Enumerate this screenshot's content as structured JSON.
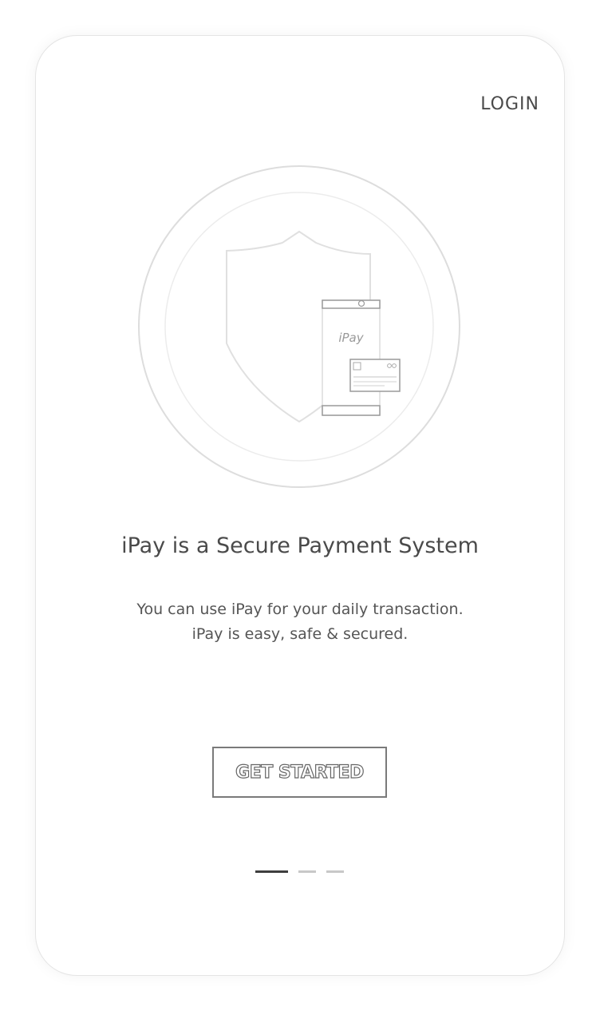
{
  "header": {
    "login_label": "LOGIN"
  },
  "illustration": {
    "icons": [
      "shield-icon",
      "phone-icon",
      "credit-card-icon"
    ],
    "phone_brand": "iPay"
  },
  "content": {
    "title": "iPay is a Secure Payment System",
    "description": "You can use iPay for your daily transaction. iPay is easy, safe & secured."
  },
  "cta": {
    "label": "GET STARTED"
  },
  "pager": {
    "total": 3,
    "active_index": 0
  },
  "colors": {
    "text": "#4a4a4a",
    "line": "#d8d8d8",
    "active_dot": "#3e3e3e",
    "inactive_dot": "#c8c8c8"
  }
}
